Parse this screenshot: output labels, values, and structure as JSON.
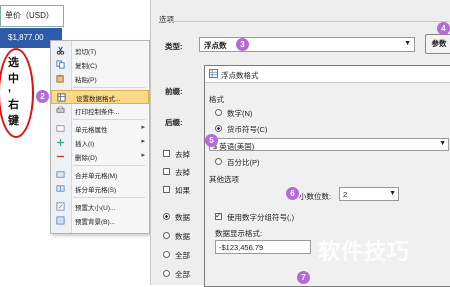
{
  "sheet": {
    "header_cell": "单价（USD）",
    "selected_cell": "$1,877.00",
    "annotation_chars": [
      "选",
      "中",
      ",",
      "右",
      "键"
    ]
  },
  "context_menu": {
    "items": [
      {
        "label": "剪切(T)",
        "icon": "scissors-icon"
      },
      {
        "label": "复制(C)",
        "icon": "copy-icon"
      },
      {
        "label": "粘贴(P)",
        "icon": "paste-icon"
      },
      {
        "label": "设置数据格式...",
        "icon": "format-icon",
        "highlighted": true
      },
      {
        "label": "打印控制条件...",
        "icon": "print-icon"
      },
      {
        "label": "单元格属性",
        "icon": "cell-icon",
        "submenu": true
      },
      {
        "label": "插入(I)",
        "icon": "insert-icon",
        "submenu": true
      },
      {
        "label": "删除(D)",
        "icon": "delete-icon",
        "submenu": true
      },
      {
        "label": "合并单元格(M)",
        "icon": "merge-icon"
      },
      {
        "label": "拆分单元格(S)",
        "icon": "split-icon"
      },
      {
        "label": "预置大小(U)...",
        "icon": "size-icon"
      },
      {
        "label": "预置背景(B)...",
        "icon": "background-icon"
      }
    ]
  },
  "dialog": {
    "section_title": "选项",
    "type_label": "类型:",
    "type_value": "浮点数",
    "params_button": "参数",
    "prefix_label": "前缀:",
    "suffix_label": "后缀:",
    "left_checks": [
      "去掉",
      "去掉",
      "如果"
    ],
    "left_radios": [
      "数据",
      "数据",
      "全部",
      "全部"
    ]
  },
  "format_panel": {
    "title": "浮点数格式",
    "format_label": "格式",
    "options": [
      "数字(N)",
      "货币符号(C)",
      "百分比(P)"
    ],
    "currency_value": "$ 英语(美国)",
    "other_options_label": "其他选项",
    "decimal_label": "小数位数:",
    "decimal_value": "2",
    "group_separator_label": "使用数字分组符号(,)",
    "display_format_label": "数据显示格式:",
    "display_format_value": "-$123,456.79"
  },
  "badges": [
    "2",
    "3",
    "4",
    "5",
    "6",
    "7"
  ],
  "watermark": "软件技巧",
  "colors": {
    "badge": "#b56ad8",
    "selection": "#2e5aa8",
    "highlight": "#fbd98a",
    "annotation": "#dd1111"
  }
}
